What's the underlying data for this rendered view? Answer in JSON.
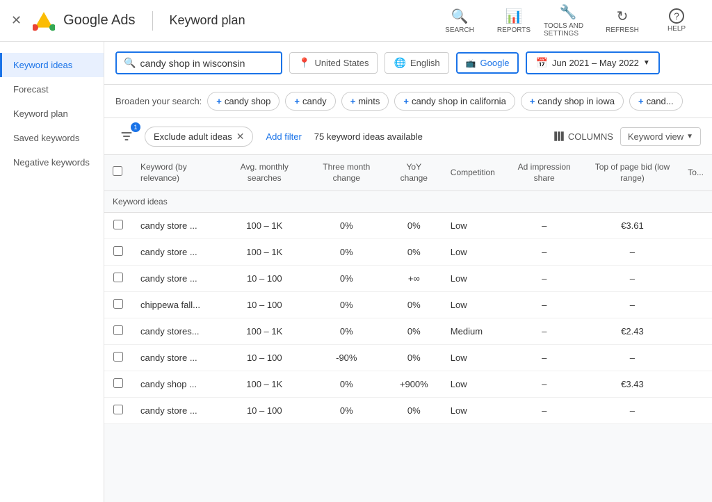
{
  "topNav": {
    "closeLabel": "✕",
    "brandName": "Google Ads",
    "pageTitle": "Keyword plan",
    "icons": [
      {
        "id": "search-nav",
        "symbol": "🔍",
        "label": "SEARCH"
      },
      {
        "id": "reports-nav",
        "symbol": "📊",
        "label": "REPORTS"
      },
      {
        "id": "tools-nav",
        "symbol": "🔧",
        "label": "TOOLS AND SETTINGS"
      },
      {
        "id": "refresh-nav",
        "symbol": "↻",
        "label": "REFRESH"
      },
      {
        "id": "help-nav",
        "symbol": "?",
        "label": "HELP"
      }
    ]
  },
  "sidebar": {
    "items": [
      {
        "id": "keyword-ideas",
        "label": "Keyword ideas",
        "active": true
      },
      {
        "id": "forecast",
        "label": "Forecast",
        "active": false
      },
      {
        "id": "keyword-plan",
        "label": "Keyword plan",
        "active": false
      },
      {
        "id": "saved-keywords",
        "label": "Saved keywords",
        "active": false
      },
      {
        "id": "negative-keywords",
        "label": "Negative keywords",
        "active": false
      }
    ]
  },
  "searchRow": {
    "searchValue": "candy shop in wisconsin",
    "searchPlaceholder": "candy shop in wisconsin",
    "locationLabel": "United States",
    "languageLabel": "English",
    "networkLabel": "Google",
    "dateRange": "Jun 2021 – May 2022"
  },
  "broadenRow": {
    "label": "Broaden your search:",
    "chips": [
      "candy shop",
      "candy",
      "mints",
      "candy shop in california",
      "candy shop in iowa",
      "cand..."
    ]
  },
  "toolbar": {
    "filterBadge": "1",
    "excludeChipLabel": "Exclude adult ideas",
    "addFilterLabel": "Add filter",
    "keywordCount": "75 keyword ideas available",
    "columnsLabel": "COLUMNS",
    "keywordViewLabel": "Keyword view"
  },
  "table": {
    "headers": [
      {
        "id": "keyword",
        "label": "Keyword (by relevance)",
        "numeric": false
      },
      {
        "id": "avg-monthly",
        "label": "Avg. monthly searches",
        "numeric": true
      },
      {
        "id": "three-month",
        "label": "Three month change",
        "numeric": true
      },
      {
        "id": "yoy-change",
        "label": "YoY change",
        "numeric": true
      },
      {
        "id": "competition",
        "label": "Competition",
        "numeric": false
      },
      {
        "id": "ad-impression",
        "label": "Ad impression share",
        "numeric": true
      },
      {
        "id": "top-bid-low",
        "label": "Top of page bid (low range)",
        "numeric": true
      },
      {
        "id": "top-bid-high",
        "label": "To...",
        "numeric": true
      }
    ],
    "sectionLabel": "Keyword ideas",
    "rows": [
      {
        "keyword": "candy store ...",
        "avgMonthly": "100 – 1K",
        "threeMonth": "0%",
        "yoy": "0%",
        "competition": "Low",
        "adShare": "–",
        "topBidLow": "€3.61",
        "topBidHigh": ""
      },
      {
        "keyword": "candy store ...",
        "avgMonthly": "100 – 1K",
        "threeMonth": "0%",
        "yoy": "0%",
        "competition": "Low",
        "adShare": "–",
        "topBidLow": "–",
        "topBidHigh": ""
      },
      {
        "keyword": "candy store ...",
        "avgMonthly": "10 – 100",
        "threeMonth": "0%",
        "yoy": "+∞",
        "competition": "Low",
        "adShare": "–",
        "topBidLow": "–",
        "topBidHigh": ""
      },
      {
        "keyword": "chippewa fall...",
        "avgMonthly": "10 – 100",
        "threeMonth": "0%",
        "yoy": "0%",
        "competition": "Low",
        "adShare": "–",
        "topBidLow": "–",
        "topBidHigh": ""
      },
      {
        "keyword": "candy stores...",
        "avgMonthly": "100 – 1K",
        "threeMonth": "0%",
        "yoy": "0%",
        "competition": "Medium",
        "adShare": "–",
        "topBidLow": "€2.43",
        "topBidHigh": ""
      },
      {
        "keyword": "candy store ...",
        "avgMonthly": "10 – 100",
        "threeMonth": "-90%",
        "yoy": "0%",
        "competition": "Low",
        "adShare": "–",
        "topBidLow": "–",
        "topBidHigh": ""
      },
      {
        "keyword": "candy shop ...",
        "avgMonthly": "100 – 1K",
        "threeMonth": "0%",
        "yoy": "+900%",
        "competition": "Low",
        "adShare": "–",
        "topBidLow": "€3.43",
        "topBidHigh": ""
      },
      {
        "keyword": "candy store ...",
        "avgMonthly": "10 – 100",
        "threeMonth": "0%",
        "yoy": "0%",
        "competition": "Low",
        "adShare": "–",
        "topBidLow": "–",
        "topBidHigh": ""
      }
    ]
  }
}
